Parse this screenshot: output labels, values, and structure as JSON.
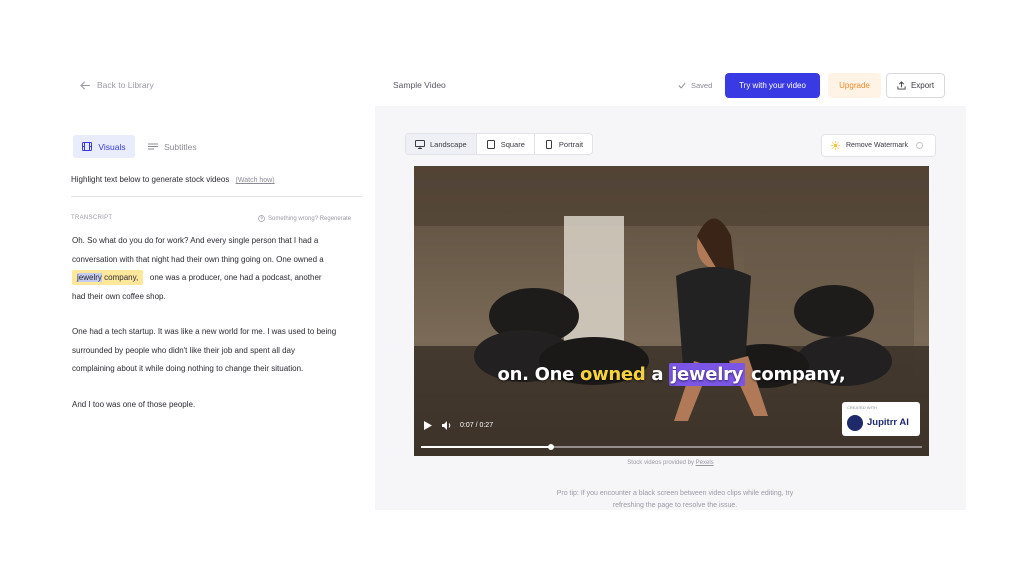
{
  "header": {
    "back_label": "Back to Library",
    "video_title": "Sample Video",
    "saved_label": "Saved",
    "try_button": "Try with your video",
    "upgrade_button": "Upgrade",
    "export_button": "Export"
  },
  "left_panel": {
    "tabs": [
      {
        "label": "Visuals",
        "icon": "film-icon",
        "active": true
      },
      {
        "label": "Subtitles",
        "icon": "lines-icon",
        "active": false
      }
    ],
    "instruction": "Highlight text below to generate stock videos",
    "watch_link": "(Watch how)",
    "transcript_label": "TRANSCRIPT",
    "regenerate_label": "Something wrong? Regenerate",
    "paragraphs": {
      "p1_line1": "Oh. So what do you do for work? And every single person that I had a",
      "p1_line2": "conversation with that night had their own thing going on. One owned a",
      "p1_hl_blue": "jewelry",
      "p1_hl_rest": " company,",
      "p1_after": "one was a producer, one had a podcast, another",
      "p1_line4": "had their own coffee shop.",
      "p2_line1": "One had a tech startup. It was like a new world for me. I was used to being",
      "p2_line2": "surrounded by people who didn't like their job and spent all day",
      "p2_line3": "complaining about it while doing nothing to change their situation.",
      "p3_line1": "And I too was one of those people."
    },
    "highlight_color": "#fde79b"
  },
  "right_panel": {
    "orientations": [
      {
        "label": "Landscape",
        "icon": "monitor-icon",
        "active": true
      },
      {
        "label": "Square",
        "icon": "square-icon",
        "active": false
      },
      {
        "label": "Portrait",
        "icon": "phone-icon",
        "active": false
      }
    ],
    "remove_watermark": "Remove Watermark",
    "caption": {
      "before": "on. One ",
      "yellow": "owned",
      "middle": " a ",
      "purple": "jewelry",
      "after": " company,"
    },
    "time_display": "0:07 / 0:27",
    "progress": 0.26,
    "badge_small": "CREATED WITH",
    "badge_name": "Jupitrr AI",
    "credit_prefix": "Stock videos provided by ",
    "credit_link": "Pexels",
    "tip": "Pro tip: If you encounter a black screen between video clips while editing, try refreshing the page to resolve the issue.",
    "accent_color": "#3a3ae4"
  }
}
